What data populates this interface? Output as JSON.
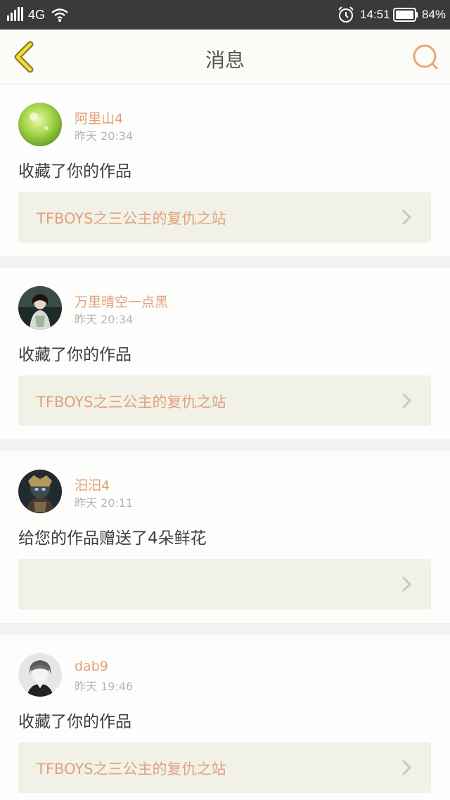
{
  "status_bar": {
    "network": "4G",
    "time": "14:51",
    "battery": "84%",
    "icons": [
      "signal-icon",
      "wifi-icon",
      "alarm-icon",
      "battery-icon"
    ]
  },
  "header": {
    "title": "消息",
    "back_icon": "back-arrow-icon",
    "search_icon": "search-icon",
    "accent_color": "#e0a27a"
  },
  "messages": [
    {
      "username": "阿里山4",
      "timestamp": "昨天 20:34",
      "action": "收藏了你的作品",
      "work_title": "TFBOYS之三公主的复仇之站"
    },
    {
      "username": "万里晴空一点黑",
      "timestamp": "昨天 20:34",
      "action": "收藏了你的作品",
      "work_title": "TFBOYS之三公主的复仇之站"
    },
    {
      "username": "汨汨4",
      "timestamp": "昨天 20:11",
      "action": "给您的作品赠送了4朵鲜花",
      "work_title": ""
    },
    {
      "username": "dab9",
      "timestamp": "昨天 19:46",
      "action": "收藏了你的作品",
      "work_title": "TFBOYS之三公主的复仇之站"
    }
  ]
}
